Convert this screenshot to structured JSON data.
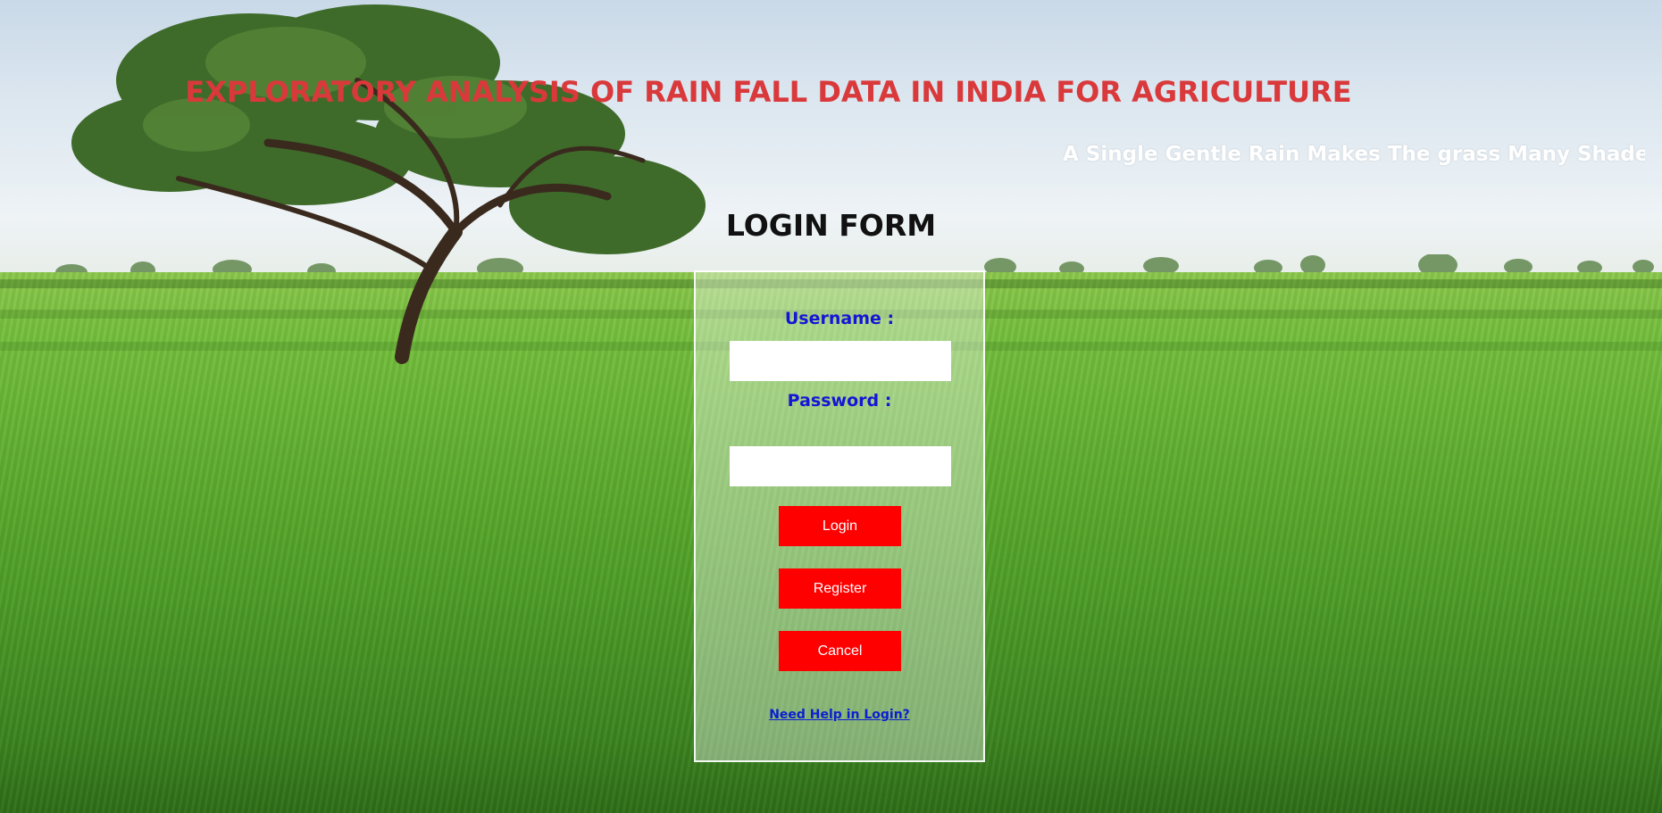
{
  "header": {
    "title": "EXPLORATORY ANALYSIS OF RAIN FALL DATA IN INDIA FOR AGRICULTURE",
    "marquee": "A Single Gentle Rain Makes The grass Many Shades Greener"
  },
  "login": {
    "heading": "LOGIN FORM",
    "username_label": "Username :",
    "username_value": "",
    "password_label": "Password :",
    "password_value": "",
    "login_button": "Login",
    "register_button": "Register",
    "cancel_button": "Cancel",
    "help_link": "Need Help in Login?"
  },
  "colors": {
    "title": "#d9393b",
    "label": "#1515d6",
    "button": "#ff0000",
    "link": "#0a1fd0"
  }
}
